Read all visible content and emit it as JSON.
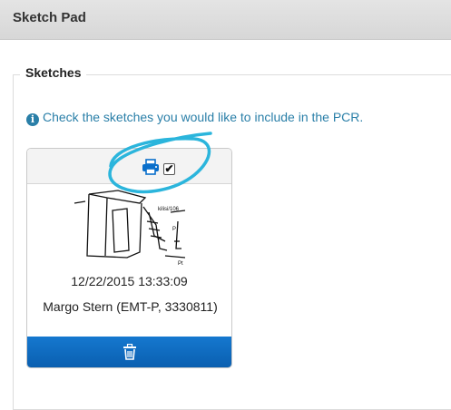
{
  "header": {
    "title": "Sketch Pad"
  },
  "section": {
    "legend": "Sketches",
    "info_text": "Check the sketches you would like to include in the PCR."
  },
  "sketch_card": {
    "print_icon": "print-icon",
    "include_checked": true,
    "checkmark": "✔",
    "date": "12/22/2015 13:33:09",
    "author": "Margo Stern (EMT-P, 3330811)",
    "delete_icon": "trash-icon"
  },
  "colors": {
    "accent_blue": "#0a6fcb",
    "info_blue": "#2a7fa8",
    "annotation_cyan": "#2bb5dc"
  }
}
